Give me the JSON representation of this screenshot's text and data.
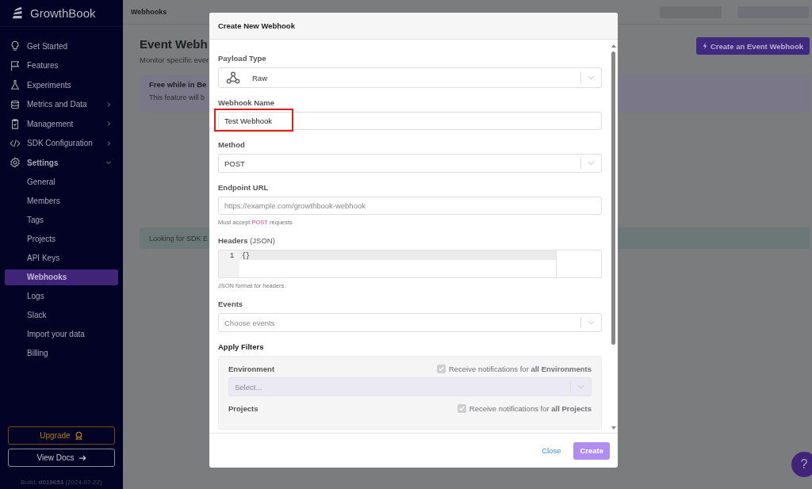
{
  "brand": {
    "name": "GrowthBook"
  },
  "sidebar": {
    "items": [
      {
        "label": "Get Started",
        "kind": "link",
        "selected": false
      },
      {
        "label": "Features",
        "kind": "link",
        "selected": false
      },
      {
        "label": "Experiments",
        "kind": "link",
        "selected": false
      },
      {
        "label": "Metrics and Data",
        "kind": "group",
        "expanded": false,
        "selected": false
      },
      {
        "label": "Management",
        "kind": "group",
        "expanded": false,
        "selected": false
      },
      {
        "label": "SDK Configuration",
        "kind": "group",
        "expanded": false,
        "selected": false
      },
      {
        "label": "Settings",
        "kind": "group",
        "expanded": true,
        "selected": false,
        "children": [
          {
            "label": "General",
            "selected": false
          },
          {
            "label": "Members",
            "selected": false
          },
          {
            "label": "Tags",
            "selected": false
          },
          {
            "label": "Projects",
            "selected": false
          },
          {
            "label": "API Keys",
            "selected": false
          },
          {
            "label": "Webhooks",
            "selected": true
          },
          {
            "label": "Logs",
            "selected": false
          },
          {
            "label": "Slack",
            "selected": false
          },
          {
            "label": "Import your data",
            "selected": false
          },
          {
            "label": "Billing",
            "selected": false
          }
        ]
      }
    ],
    "upgrade": "Upgrade",
    "docs": "View Docs",
    "build": "Build: **d019653** (2024-07-22)"
  },
  "header": {
    "breadcrumb": "Webhooks"
  },
  "page": {
    "title": "Event Webh",
    "subtitle": "Monitor specific ever",
    "create_button": "Create an Event Webhook",
    "beta_title": "Free while in Be",
    "beta_text": "This feature will b",
    "sdk_notice": "Looking for SDK E"
  },
  "modal": {
    "title": "Create New Webhook",
    "fields": [
      {
        "kind": "icon_select",
        "label": "Payload Type",
        "value": "Raw"
      },
      {
        "kind": "text",
        "label": "Webhook Name",
        "value": "Test Webhook",
        "highlighted": true
      },
      {
        "kind": "select",
        "label": "Method",
        "value": "POST"
      },
      {
        "kind": "url",
        "label": "Endpoint URL",
        "placeholder": "https://example.com/growthbook-webhook",
        "help_before": "Must accept",
        "help_code": "POST",
        "help_after": "requests"
      },
      {
        "kind": "code",
        "label": "Headers",
        "label_suffix": "(JSON)",
        "line_number": "1",
        "code": "{}",
        "help": "JSON format for headers."
      },
      {
        "kind": "select",
        "label": "Events",
        "placeholder": "Choose events"
      }
    ],
    "filters": {
      "title": "Apply Filters",
      "groups": [
        {
          "label": "Environment",
          "checkbox": "Receive notifications for **all Environments**",
          "checked": true,
          "disabled": true,
          "placeholder": "Select..."
        },
        {
          "label": "Projects",
          "checkbox": "Receive notifications for **all Projects**",
          "checked": true,
          "disabled": true
        }
      ]
    },
    "close": "Close",
    "create": "Create",
    "create_disabled": true
  },
  "help_button": "?"
}
